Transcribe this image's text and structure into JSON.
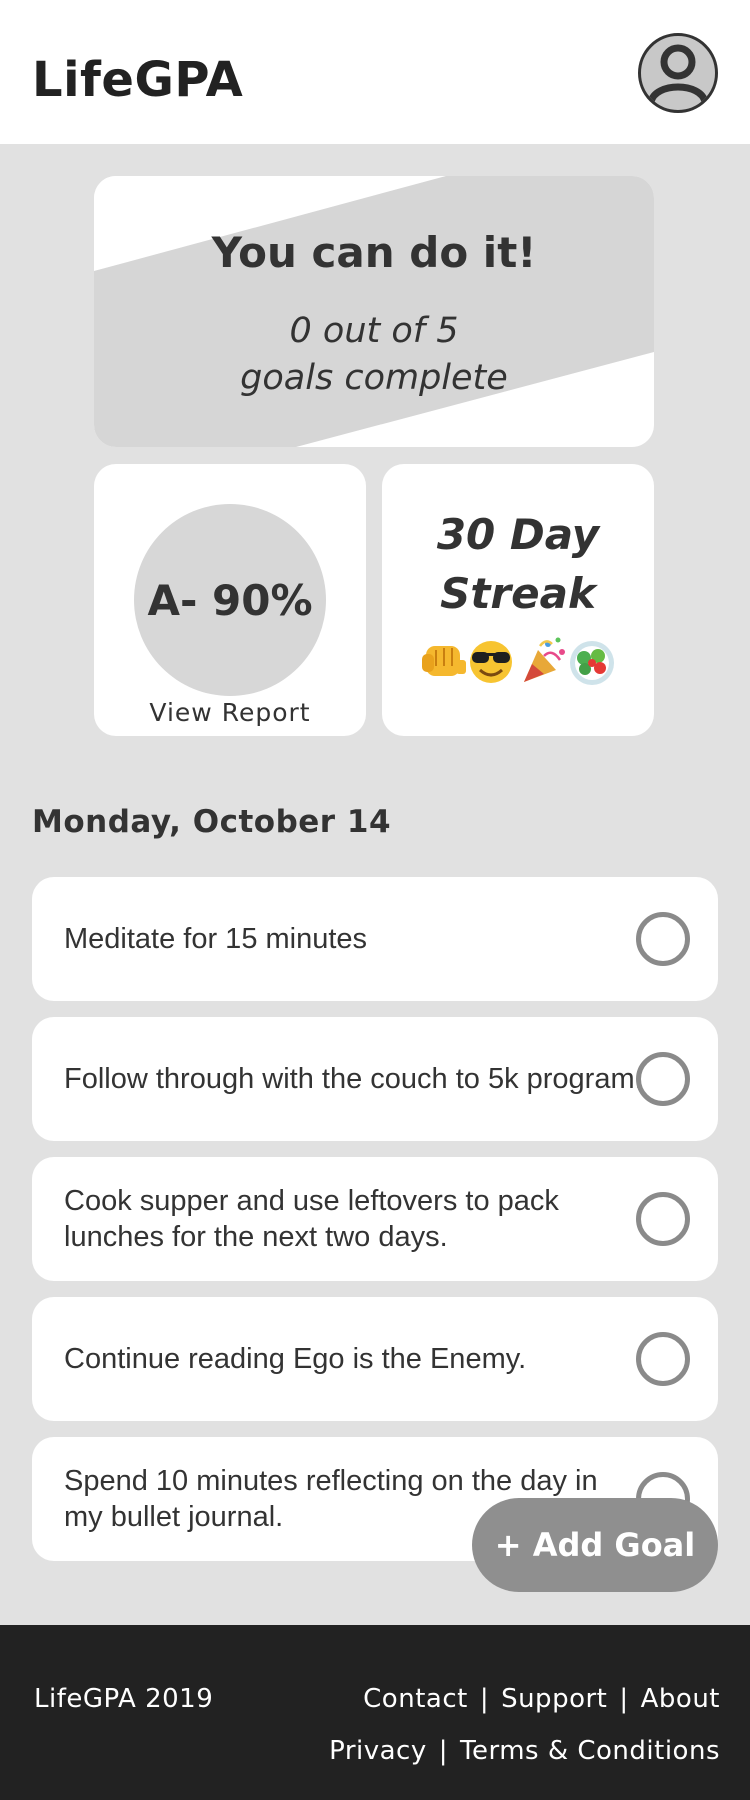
{
  "header": {
    "app_title": "LifeGPA",
    "avatar_icon": "user-avatar-icon"
  },
  "motivation": {
    "headline": "You can do it!",
    "progress_line1": "0 out of 5",
    "progress_line2": "goals complete",
    "goals_complete": 0,
    "goals_total": 5
  },
  "grade_card": {
    "grade": "A- 90%",
    "link_label": "View Report"
  },
  "streak_card": {
    "line1": "30 Day",
    "line2": "Streak",
    "emoji_icons": [
      "fist-bump-icon",
      "sunglasses-face-icon",
      "party-popper-icon",
      "salad-icon"
    ]
  },
  "date_heading": "Monday, October 14",
  "goals": [
    {
      "text": "Meditate for 15 minutes",
      "completed": false
    },
    {
      "text": "Follow through with the couch to 5k program.",
      "completed": false
    },
    {
      "text": "Cook supper and use leftovers to pack lunches for the next two days.",
      "completed": false
    },
    {
      "text": "Continue reading Ego is the Enemy.",
      "completed": false
    },
    {
      "text": "Spend 10 minutes reflecting on the day in my bullet journal.",
      "completed": false
    }
  ],
  "add_goal_label": "+ Add Goal",
  "footer": {
    "copyright": "LifeGPA 2019",
    "links_row1": [
      "Contact",
      "Support",
      "About"
    ],
    "links_row2": [
      "Privacy",
      "Terms & Conditions"
    ],
    "separator": "|"
  },
  "colors": {
    "page_background": "#e1e1e1",
    "card_background": "#ffffff",
    "accent_gray": "#8f8f8f",
    "footer_background": "#222222",
    "text": "#333333"
  }
}
